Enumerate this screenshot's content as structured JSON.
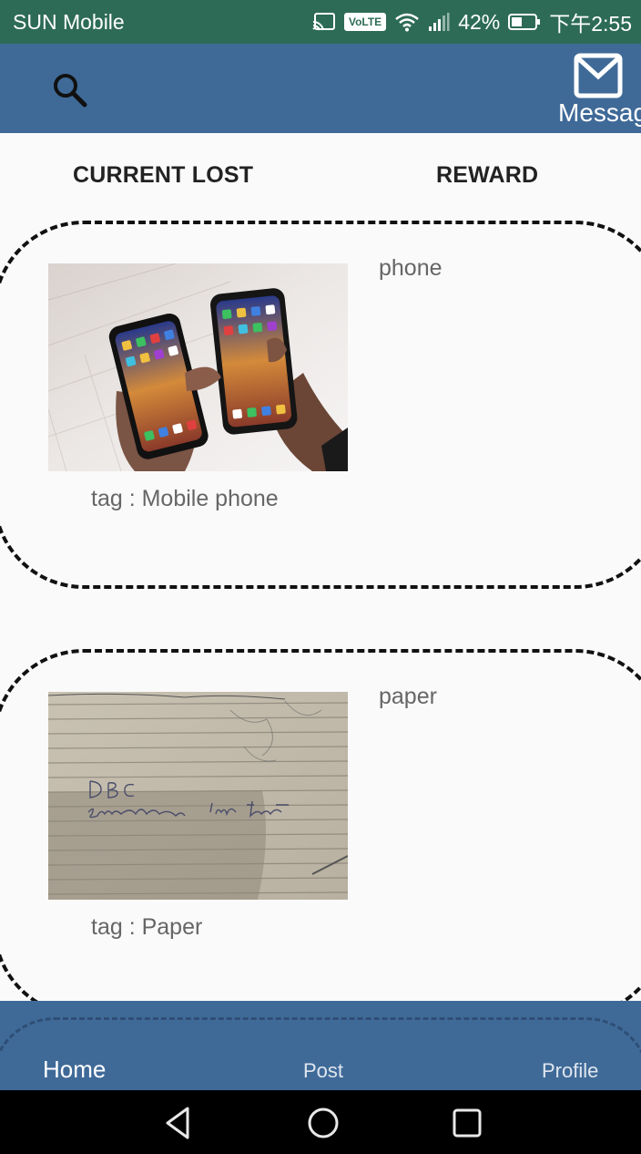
{
  "status_bar": {
    "carrier": "SUN Mobile",
    "volte": "VoLTE",
    "battery": "42%",
    "time": "下午2:55"
  },
  "app_bar": {
    "search_icon": "search-icon",
    "message_icon": "envelope-icon",
    "message_label": "Message"
  },
  "tabs": {
    "current_lost": "CURRENT LOST",
    "reward": "REWARD"
  },
  "items": [
    {
      "name": "phone",
      "tag": "tag : Mobile phone",
      "image": "phones-photo"
    },
    {
      "name": "paper",
      "tag": "tag : Paper",
      "image": "paper-note-photo"
    }
  ],
  "bottom_nav": {
    "home": "Home",
    "post": "Post",
    "profile": "Profile"
  },
  "system_nav": {
    "back_icon": "back-triangle-icon",
    "home_icon": "home-circle-icon",
    "recents_icon": "recents-square-icon"
  },
  "colors": {
    "status_bar": "#2d6b57",
    "app_bar": "#3f6a98",
    "background": "#fafafa"
  }
}
